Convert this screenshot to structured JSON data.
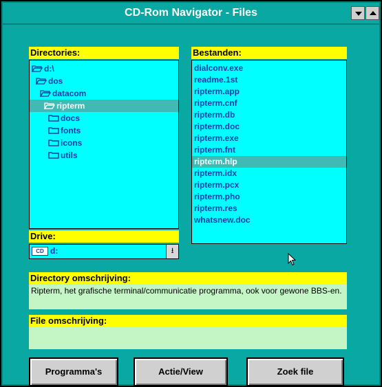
{
  "window": {
    "title": "CD-Rom Navigator - Files",
    "minimize_icon": "arrow-down-icon",
    "maximize_icon": "arrow-up-icon"
  },
  "directories": {
    "label": "Directories:",
    "items": [
      {
        "name": "d:\\",
        "level": 0,
        "open": true,
        "selected": false
      },
      {
        "name": "dos",
        "level": 1,
        "open": true,
        "selected": false
      },
      {
        "name": "datacom",
        "level": 2,
        "open": true,
        "selected": false
      },
      {
        "name": "ripterm",
        "level": 3,
        "open": true,
        "selected": true
      },
      {
        "name": "docs",
        "level": 4,
        "open": false,
        "selected": false
      },
      {
        "name": "fonts",
        "level": 4,
        "open": false,
        "selected": false
      },
      {
        "name": "icons",
        "level": 4,
        "open": false,
        "selected": false
      },
      {
        "name": "utils",
        "level": 4,
        "open": false,
        "selected": false
      }
    ]
  },
  "files": {
    "label": "Bestanden:",
    "items": [
      "dialconv.exe",
      "readme.1st",
      "ripterm.app",
      "ripterm.cnf",
      "ripterm.db",
      "ripterm.doc",
      "ripterm.exe",
      "ripterm.fnt",
      "ripterm.hlp",
      "ripterm.idx",
      "ripterm.pcx",
      "ripterm.pho",
      "ripterm.res",
      "whatsnew.doc"
    ],
    "selected": "ripterm.hlp"
  },
  "drive": {
    "label": "Drive:",
    "icon_text": "CD",
    "value": "d:",
    "dropdown_icon": "dropdown-arrow-icon"
  },
  "directory_description": {
    "label": "Directory omschrijving:",
    "text": "Ripterm, het grafische terminal/communicatie programma, ook voor gewone BBS-en."
  },
  "file_description": {
    "label": "File omschrijving:",
    "text": ""
  },
  "buttons": {
    "programs": "Programma's",
    "action": "Actie/View",
    "search": "Zoek file"
  },
  "colors": {
    "window_bg": "#0aa8a2",
    "panel_bg": "#00ffff",
    "label_bg": "#ffff00",
    "selection": "#3fbab4",
    "text_blue": "#1b3aa8",
    "desc_bg": "#c4f5c4"
  }
}
